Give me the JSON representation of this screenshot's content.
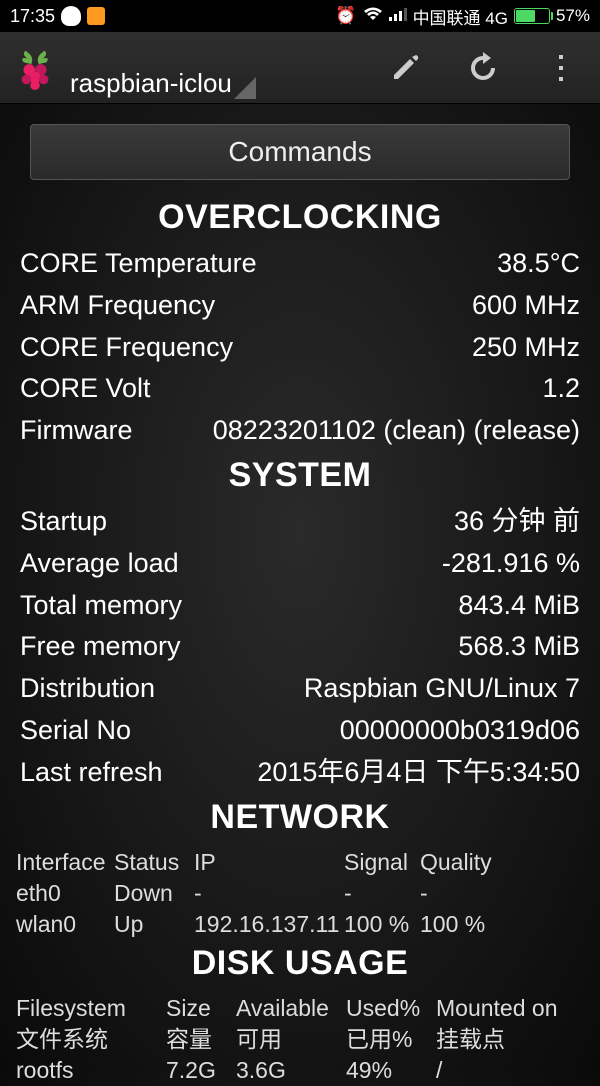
{
  "status": {
    "time": "17:35",
    "carrier": "中国联通 4G",
    "battery_pct": "57%"
  },
  "header": {
    "title": "raspbian-iclou"
  },
  "commands_label": "Commands",
  "sections": {
    "overclocking": {
      "title": "OVERCLOCKING",
      "rows": {
        "core_temp_label": "CORE Temperature",
        "core_temp_value": "38.5°C",
        "arm_freq_label": "ARM Frequency",
        "arm_freq_value": "600 MHz",
        "core_freq_label": "CORE Frequency",
        "core_freq_value": "250 MHz",
        "core_volt_label": "CORE Volt",
        "core_volt_value": "1.2",
        "firmware_label": "Firmware",
        "firmware_value": "08223201102 (clean) (release)"
      }
    },
    "system": {
      "title": "SYSTEM",
      "rows": {
        "startup_label": "Startup",
        "startup_value": "36 分钟 前",
        "avg_load_label": "Average load",
        "avg_load_value": "-281.916 %",
        "total_mem_label": "Total memory",
        "total_mem_value": "843.4 MiB",
        "free_mem_label": "Free memory",
        "free_mem_value": "568.3 MiB",
        "distribution_label": "Distribution",
        "distribution_value": "Raspbian GNU/Linux 7",
        "serial_label": "Serial No",
        "serial_value": "00000000b0319d06",
        "last_refresh_label": "Last refresh",
        "last_refresh_value": "2015年6月4日 下午5:34:50"
      }
    },
    "network": {
      "title": "NETWORK",
      "headers": {
        "interface": "Interface",
        "status": "Status",
        "ip": "IP",
        "signal": "Signal",
        "quality": "Quality"
      },
      "rows": [
        {
          "interface": "eth0",
          "status": "Down",
          "ip": "-",
          "signal": "-",
          "quality": "-"
        },
        {
          "interface": "wlan0",
          "status": "Up",
          "ip": "192.16.137.11",
          "signal": "100 %",
          "quality": "100 %"
        }
      ]
    },
    "disk": {
      "title": "DISK USAGE",
      "headers_en": {
        "filesystem": "Filesystem",
        "size": "Size",
        "available": "Available",
        "used_pct": "Used%",
        "mounted": "Mounted on"
      },
      "headers_zh": {
        "filesystem": "文件系统",
        "size": "容量",
        "available": "可用",
        "used_pct": "已用%",
        "mounted": "挂载点"
      },
      "rows": [
        {
          "filesystem": "rootfs",
          "size": "7.2G",
          "available": "3.6G",
          "used_pct": "49%",
          "mounted": "/"
        }
      ]
    }
  }
}
